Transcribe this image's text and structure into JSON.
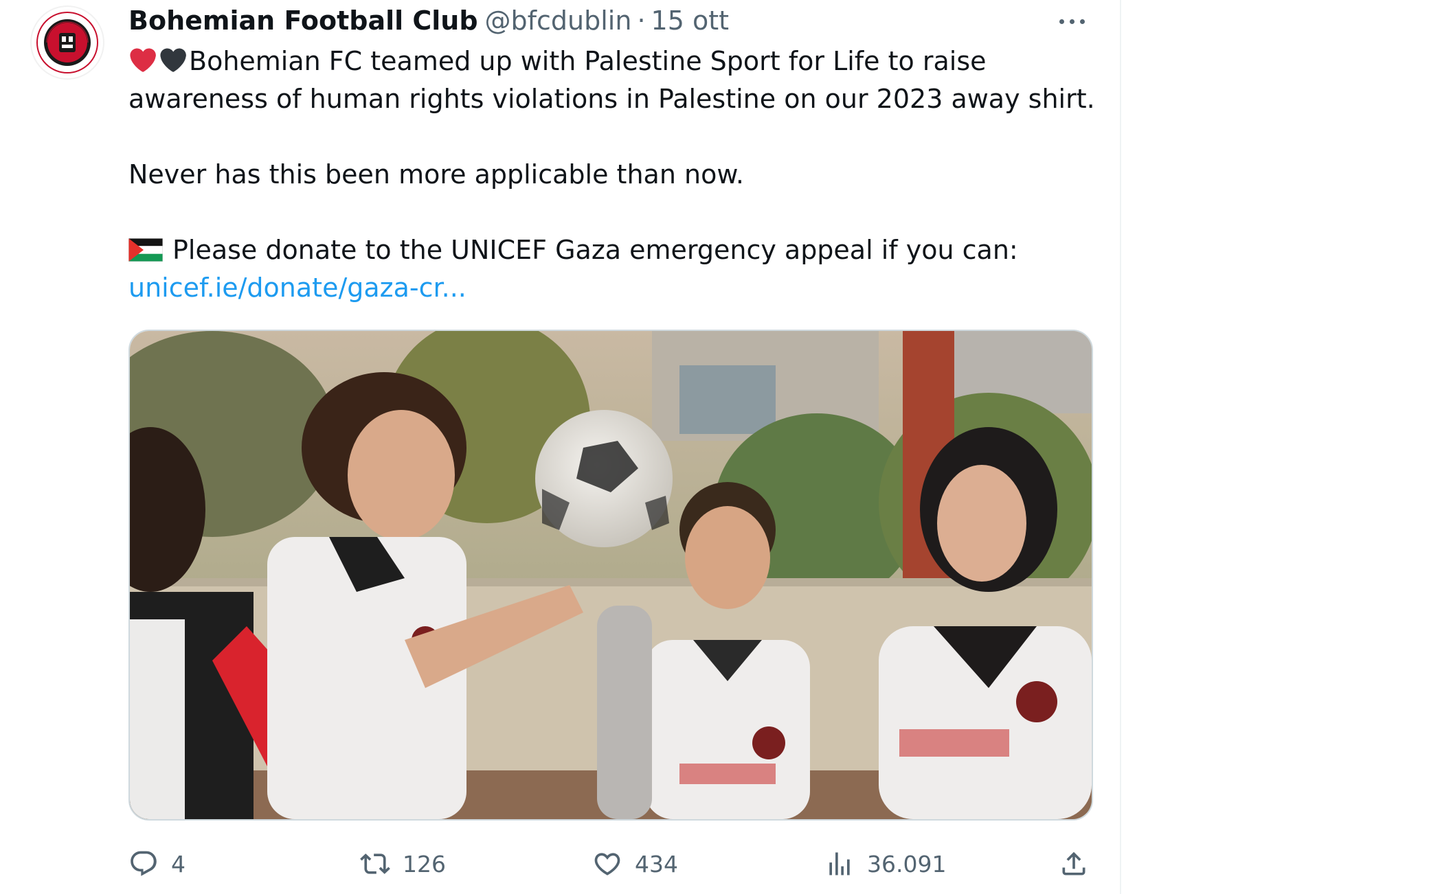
{
  "tweet": {
    "author": {
      "display_name": "Bohemian Football Club",
      "handle": "@bfcdublin"
    },
    "separator": "·",
    "date": "15 ott",
    "text_lines": [
      "Bohemian FC teamed up with Palestine Sport for Life to raise",
      "awareness of human rights violations in Palestine on our 2023 away shirt.",
      "Never has this been more applicable than now.",
      "Please donate to the UNICEF Gaza emergency appeal if you can:"
    ],
    "link_text": "unicef.ie/donate/gaza-cr...",
    "emojis": [
      "red-heart",
      "black-heart",
      "palestine-flag"
    ],
    "media_description_icons": [
      "photo"
    ],
    "metrics": {
      "replies": "4",
      "reposts": "126",
      "likes": "434",
      "views": "36.091"
    },
    "icons": {
      "reply": "reply-icon",
      "repost": "repost-icon",
      "like": "like-icon",
      "views": "views-icon",
      "share": "share-icon",
      "more": "more-icon"
    },
    "colors": {
      "text_primary": "#0f1419",
      "text_secondary": "#536471",
      "link": "#1d9bf0",
      "heart_red": "#f4233a",
      "heart_black": "#31373d"
    }
  }
}
